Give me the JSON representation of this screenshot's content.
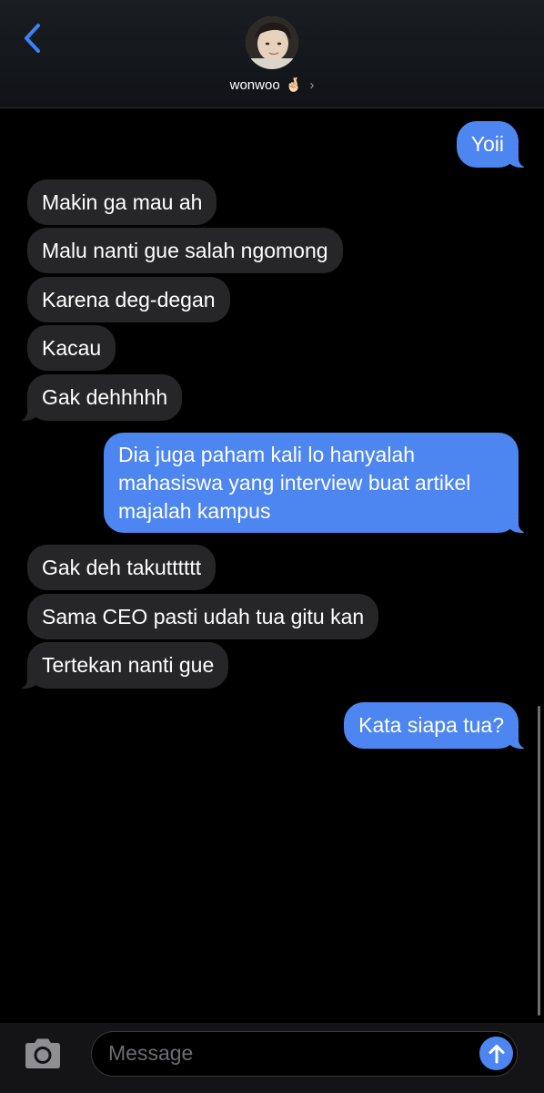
{
  "header": {
    "back_icon": "chevron-left-icon",
    "contact_name": "wonwoo",
    "contact_emoji": "🤞🏻",
    "chevron": "›"
  },
  "messages": [
    {
      "side": "sent",
      "text": "Yoii"
    },
    {
      "side": "received",
      "text": "Makin ga mau ah"
    },
    {
      "side": "received",
      "text": "Malu nanti gue salah ngomong"
    },
    {
      "side": "received",
      "text": "Karena deg-degan"
    },
    {
      "side": "received",
      "text": "Kacau"
    },
    {
      "side": "received",
      "text": "Gak dehhhhh"
    },
    {
      "side": "sent",
      "text": "Dia juga paham kali lo hanyalah mahasiswa yang interview buat artikel majalah kampus"
    },
    {
      "side": "received",
      "text": "Gak deh takutttttt"
    },
    {
      "side": "received",
      "text": "Sama CEO pasti udah tua gitu kan"
    },
    {
      "side": "received",
      "text": "Tertekan nanti gue"
    },
    {
      "side": "sent",
      "text": "Kata siapa tua?"
    }
  ],
  "composer": {
    "placeholder": "Message",
    "camera_icon": "camera-icon",
    "send_icon": "arrow-up-icon"
  },
  "colors": {
    "sent_bubble": "#4d86f0",
    "received_bubble": "#262628",
    "accent": "#3b82f6"
  }
}
